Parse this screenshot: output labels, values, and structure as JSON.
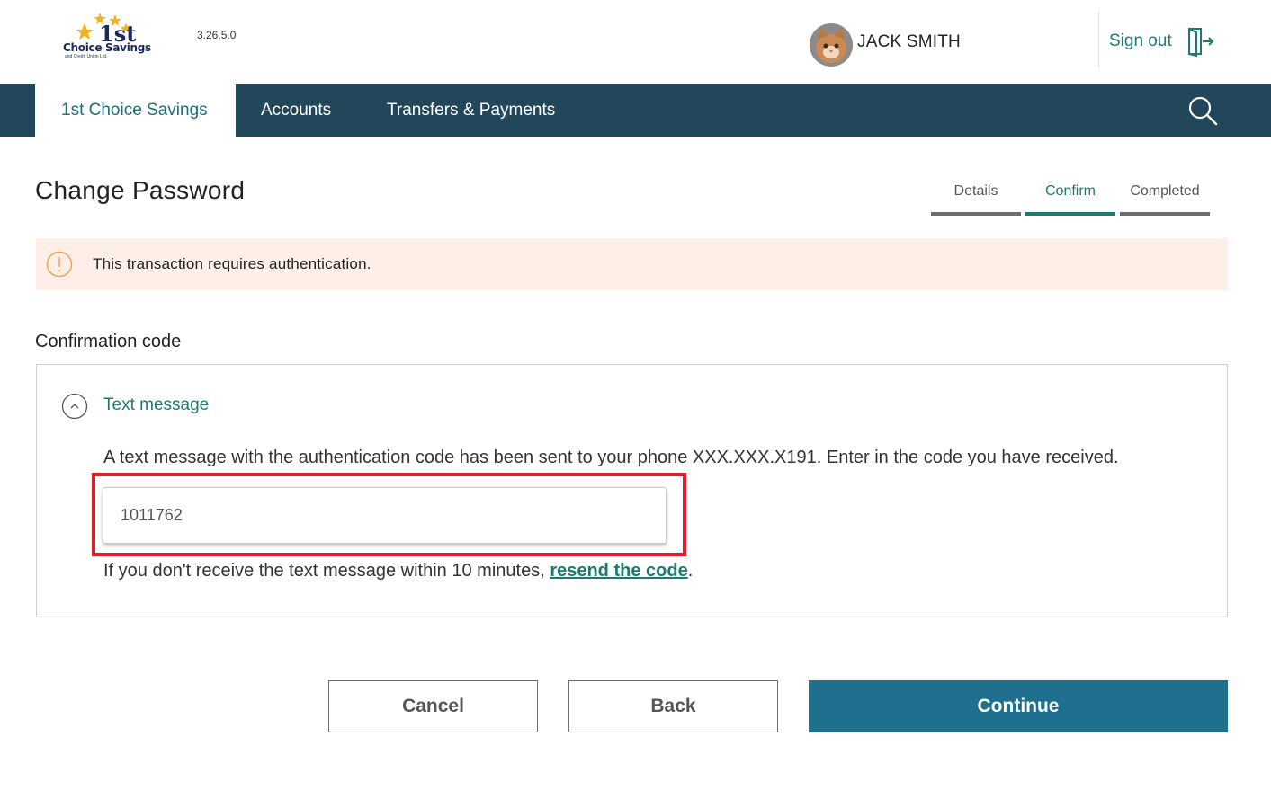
{
  "header": {
    "logo_text": "Choice Savings",
    "logo_sub": "and Credit Union Ltd.",
    "logo_mark": "1st",
    "version": "3.26.5.0",
    "user_name": "JACK SMITH",
    "signout_label": "Sign out"
  },
  "nav": {
    "items": [
      {
        "label": "1st Choice Savings",
        "active": true
      },
      {
        "label": "Accounts",
        "active": false
      },
      {
        "label": "Transfers & Payments",
        "active": false
      }
    ]
  },
  "page": {
    "title": "Change Password",
    "steps": [
      {
        "label": "Details",
        "active": false
      },
      {
        "label": "Confirm",
        "active": true
      },
      {
        "label": "Completed",
        "active": false
      }
    ]
  },
  "alert": {
    "text": "This transaction requires authentication."
  },
  "confirmation": {
    "label": "Confirmation code",
    "method_label": "Text message",
    "description": "A text message with the authentication code has been sent to your phone XXX.XXX.X191. Enter in the code you have received.",
    "code_value": "1011762",
    "resend_prefix": "If you don't receive the text message within 10 minutes, ",
    "resend_link": "resend the code",
    "resend_suffix": "."
  },
  "buttons": {
    "cancel": "Cancel",
    "back": "Back",
    "continue": "Continue"
  },
  "colors": {
    "nav_bg": "#22465a",
    "accent_green": "#1d7a6e",
    "primary_button": "#1f6f8e",
    "alert_bg": "#fdefe7",
    "highlight_red": "#e01c2a"
  }
}
